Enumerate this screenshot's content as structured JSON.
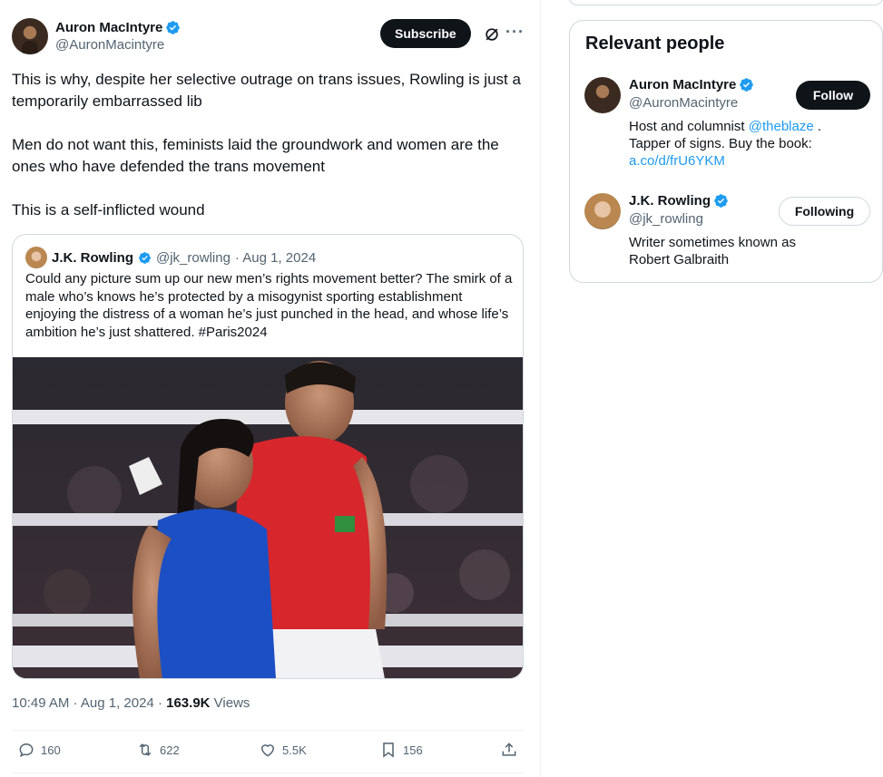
{
  "tweet": {
    "author_name": "Auron MacIntyre",
    "author_handle": "@AuronMacintyre",
    "subscribe_label": "Subscribe",
    "more_label": "···",
    "paragraphs": [
      "This is why, despite her selective outrage on trans issues, Rowling is just a temporarily embarrassed lib",
      "Men do not want this, feminists laid the groundwork and women are the ones who have defended the trans movement",
      "This is a self-inflicted wound"
    ],
    "timestamp": "10:49 AM · Aug 1, 2024 · ",
    "views_count": "163.9K",
    "views_label": " Views"
  },
  "quote": {
    "author_name": "J.K. Rowling",
    "author_handle": "@jk_rowling",
    "date": "· Aug 1, 2024",
    "text": "Could any picture sum up our new men’s rights movement better? The smirk of a male who’s knows he’s protected by a misogynist sporting establishment enjoying the distress of a woman he’s just punched in the head, and whose life’s ambition he’s just shattered. #Paris2024"
  },
  "actions": {
    "replies": "160",
    "reposts": "622",
    "likes": "5.5K",
    "bookmarks": "156"
  },
  "sidebar": {
    "title": "Relevant people",
    "people": [
      {
        "name": "Auron MacIntyre",
        "handle": "@AuronMacintyre",
        "button": "Follow",
        "bio_pre": "Host and columnist ",
        "bio_link1": "@theblaze",
        "bio_mid": " . Tapper of signs. Buy the book: ",
        "bio_link2": "a.co/d/frU6YKM"
      },
      {
        "name": "J.K. Rowling",
        "handle": "@jk_rowling",
        "button": "Following",
        "bio": "Writer sometimes known as Robert Galbraith"
      }
    ]
  },
  "colors": {
    "accent": "#1d9bf0",
    "text": "#0f1419",
    "muted": "#536471",
    "border": "#cfd9de"
  }
}
